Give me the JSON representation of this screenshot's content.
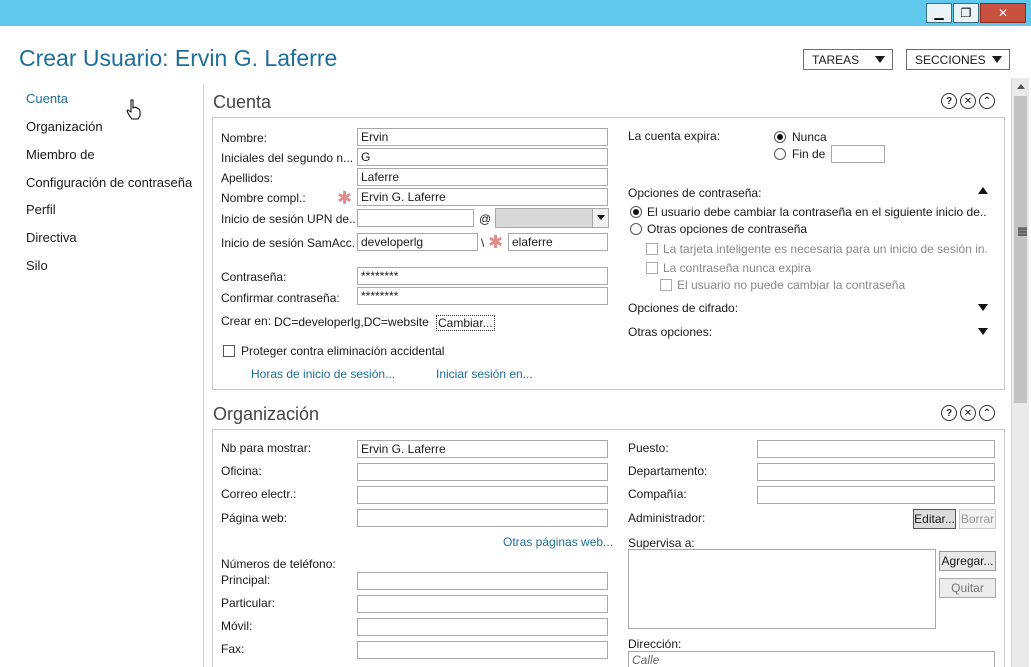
{
  "window": {
    "minimize": "▁",
    "restore": "❐",
    "close": "✕"
  },
  "header": {
    "title": "Crear Usuario: Ervin G. Laferre",
    "tasks_label": "TAREAS",
    "sections_label": "SECCIONES"
  },
  "nav": {
    "items": [
      "Cuenta",
      "Organización",
      "Miembro de",
      "Configuración de contraseña",
      "Perfil",
      "Directiva",
      "Silo"
    ]
  },
  "cuenta": {
    "title": "Cuenta",
    "nombre_label": "Nombre:",
    "nombre_value": "Ervin",
    "iniciales_label": "Iniciales del segundo n...",
    "iniciales_value": "G",
    "apellidos_label": "Apellidos:",
    "apellidos_value": "Laferre",
    "nombre_compl_label": "Nombre compl.:",
    "nombre_compl_value": "Ervin G. Laferre",
    "upn_label": "Inicio de sesión UPN de...",
    "upn_value": "",
    "at_sign": "@",
    "sam_label": "Inicio de sesión SamAcc...",
    "sam_domain": "developerlg",
    "sam_sep": "\\",
    "sam_user": "elaferre",
    "password_label": "Contraseña:",
    "password_value": "********",
    "confirm_label": "Confirmar contraseña:",
    "confirm_value": "********",
    "create_in_label": "Crear en:",
    "create_in_value": "DC=developerlg,DC=website",
    "change_link": "Cambiar...",
    "protect_label": "Proteger contra eliminación accidental",
    "logon_hours_link": "Horas de inicio de sesión...",
    "logon_to_link": "Iniciar sesión en...",
    "expires_label": "La cuenta expira:",
    "never_label": "Nunca",
    "end_label": "Fin de",
    "end_value": "",
    "pw_options_label": "Opciones de contraseña:",
    "must_change_label": "El usuario debe cambiar la contraseña en el siguiente inicio de...",
    "other_pw_label": "Otras opciones de contraseña",
    "smartcard_label": "La tarjeta inteligente es necesaria para un inicio de sesión in...",
    "never_expires_label": "La contraseña nunca expira",
    "cannot_change_label": "El usuario no puede cambiar la contraseña",
    "encryption_label": "Opciones de cifrado:",
    "other_options_label": "Otras opciones:"
  },
  "organizacion": {
    "title": "Organización",
    "display_label": "Nb para mostrar:",
    "display_value": "Ervin G. Laferre",
    "office_label": "Oficina:",
    "office_value": "",
    "email_label": "Correo electr.:",
    "email_value": "",
    "web_label": "Página web:",
    "web_value": "",
    "other_web_link": "Otras páginas web...",
    "phones_label": "Números de teléfono:",
    "main_label": "Principal:",
    "home_label": "Particular:",
    "mobile_label": "Móvil:",
    "fax_label": "Fax:",
    "job_label": "Puesto:",
    "job_value": "",
    "dept_label": "Departamento:",
    "dept_value": "",
    "company_label": "Compañía:",
    "company_value": "",
    "manager_label": "Administrador:",
    "edit_button": "Editar...",
    "clear_button": "Borrar",
    "direct_reports_label": "Supervisa a:",
    "add_button": "Agregar...",
    "remove_button": "Quitar",
    "address_label": "Dirección:",
    "street_placeholder": "Calle"
  },
  "section_icons": {
    "help": "?",
    "close": "✕",
    "collapse": "⌃"
  }
}
